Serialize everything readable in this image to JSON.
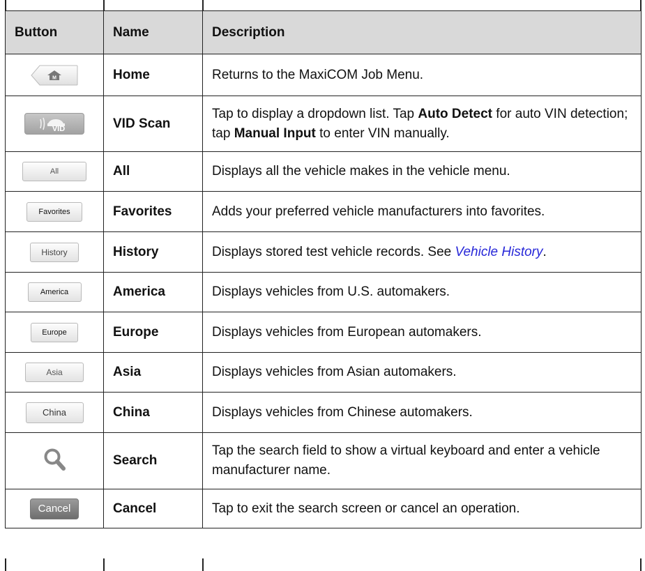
{
  "table": {
    "headers": {
      "button": "Button",
      "name": "Name",
      "description": "Description"
    },
    "rows": [
      {
        "button_icon": "home-icon",
        "name": "Home",
        "desc_parts": [
          "Returns to the MaxiCOM Job Menu."
        ]
      },
      {
        "button_icon": "vid-scan-icon",
        "name": "VID Scan",
        "desc_parts": [
          "Tap to display a dropdown list. Tap ",
          "Auto Detect",
          " for auto VIN detection; tap ",
          "Manual Input",
          " to enter VIN manually."
        ]
      },
      {
        "button_label": "All",
        "name": "All",
        "desc_parts": [
          "Displays all the vehicle makes in the vehicle menu."
        ]
      },
      {
        "button_label": "Favorites",
        "name": "Favorites",
        "desc_parts": [
          "Adds your preferred vehicle manufacturers into favorites."
        ]
      },
      {
        "button_label": "History",
        "name": "History",
        "desc_parts": [
          "Displays stored test vehicle records. See ",
          "Vehicle History",
          "."
        ]
      },
      {
        "button_label": "America",
        "name": "America",
        "desc_parts": [
          "Displays vehicles from U.S. automakers."
        ]
      },
      {
        "button_label": "Europe",
        "name": "Europe",
        "desc_parts": [
          "Displays vehicles from European automakers."
        ]
      },
      {
        "button_label": "Asia",
        "name": "Asia",
        "desc_parts": [
          "Displays vehicles from Asian automakers."
        ]
      },
      {
        "button_label": "China",
        "name": "China",
        "desc_parts": [
          "Displays vehicles from Chinese automakers."
        ]
      },
      {
        "button_icon": "search-icon",
        "name": "Search",
        "desc_parts": [
          "Tap the search field to show a virtual keyboard and enter a vehicle manufacturer name."
        ]
      },
      {
        "button_label": "Cancel",
        "name": "Cancel",
        "desc_parts": [
          "Tap to exit the search screen or cancel an operation."
        ]
      }
    ]
  },
  "colors": {
    "header_bg": "#d9d9d9",
    "link": "#2727d8",
    "border": "#222222"
  }
}
